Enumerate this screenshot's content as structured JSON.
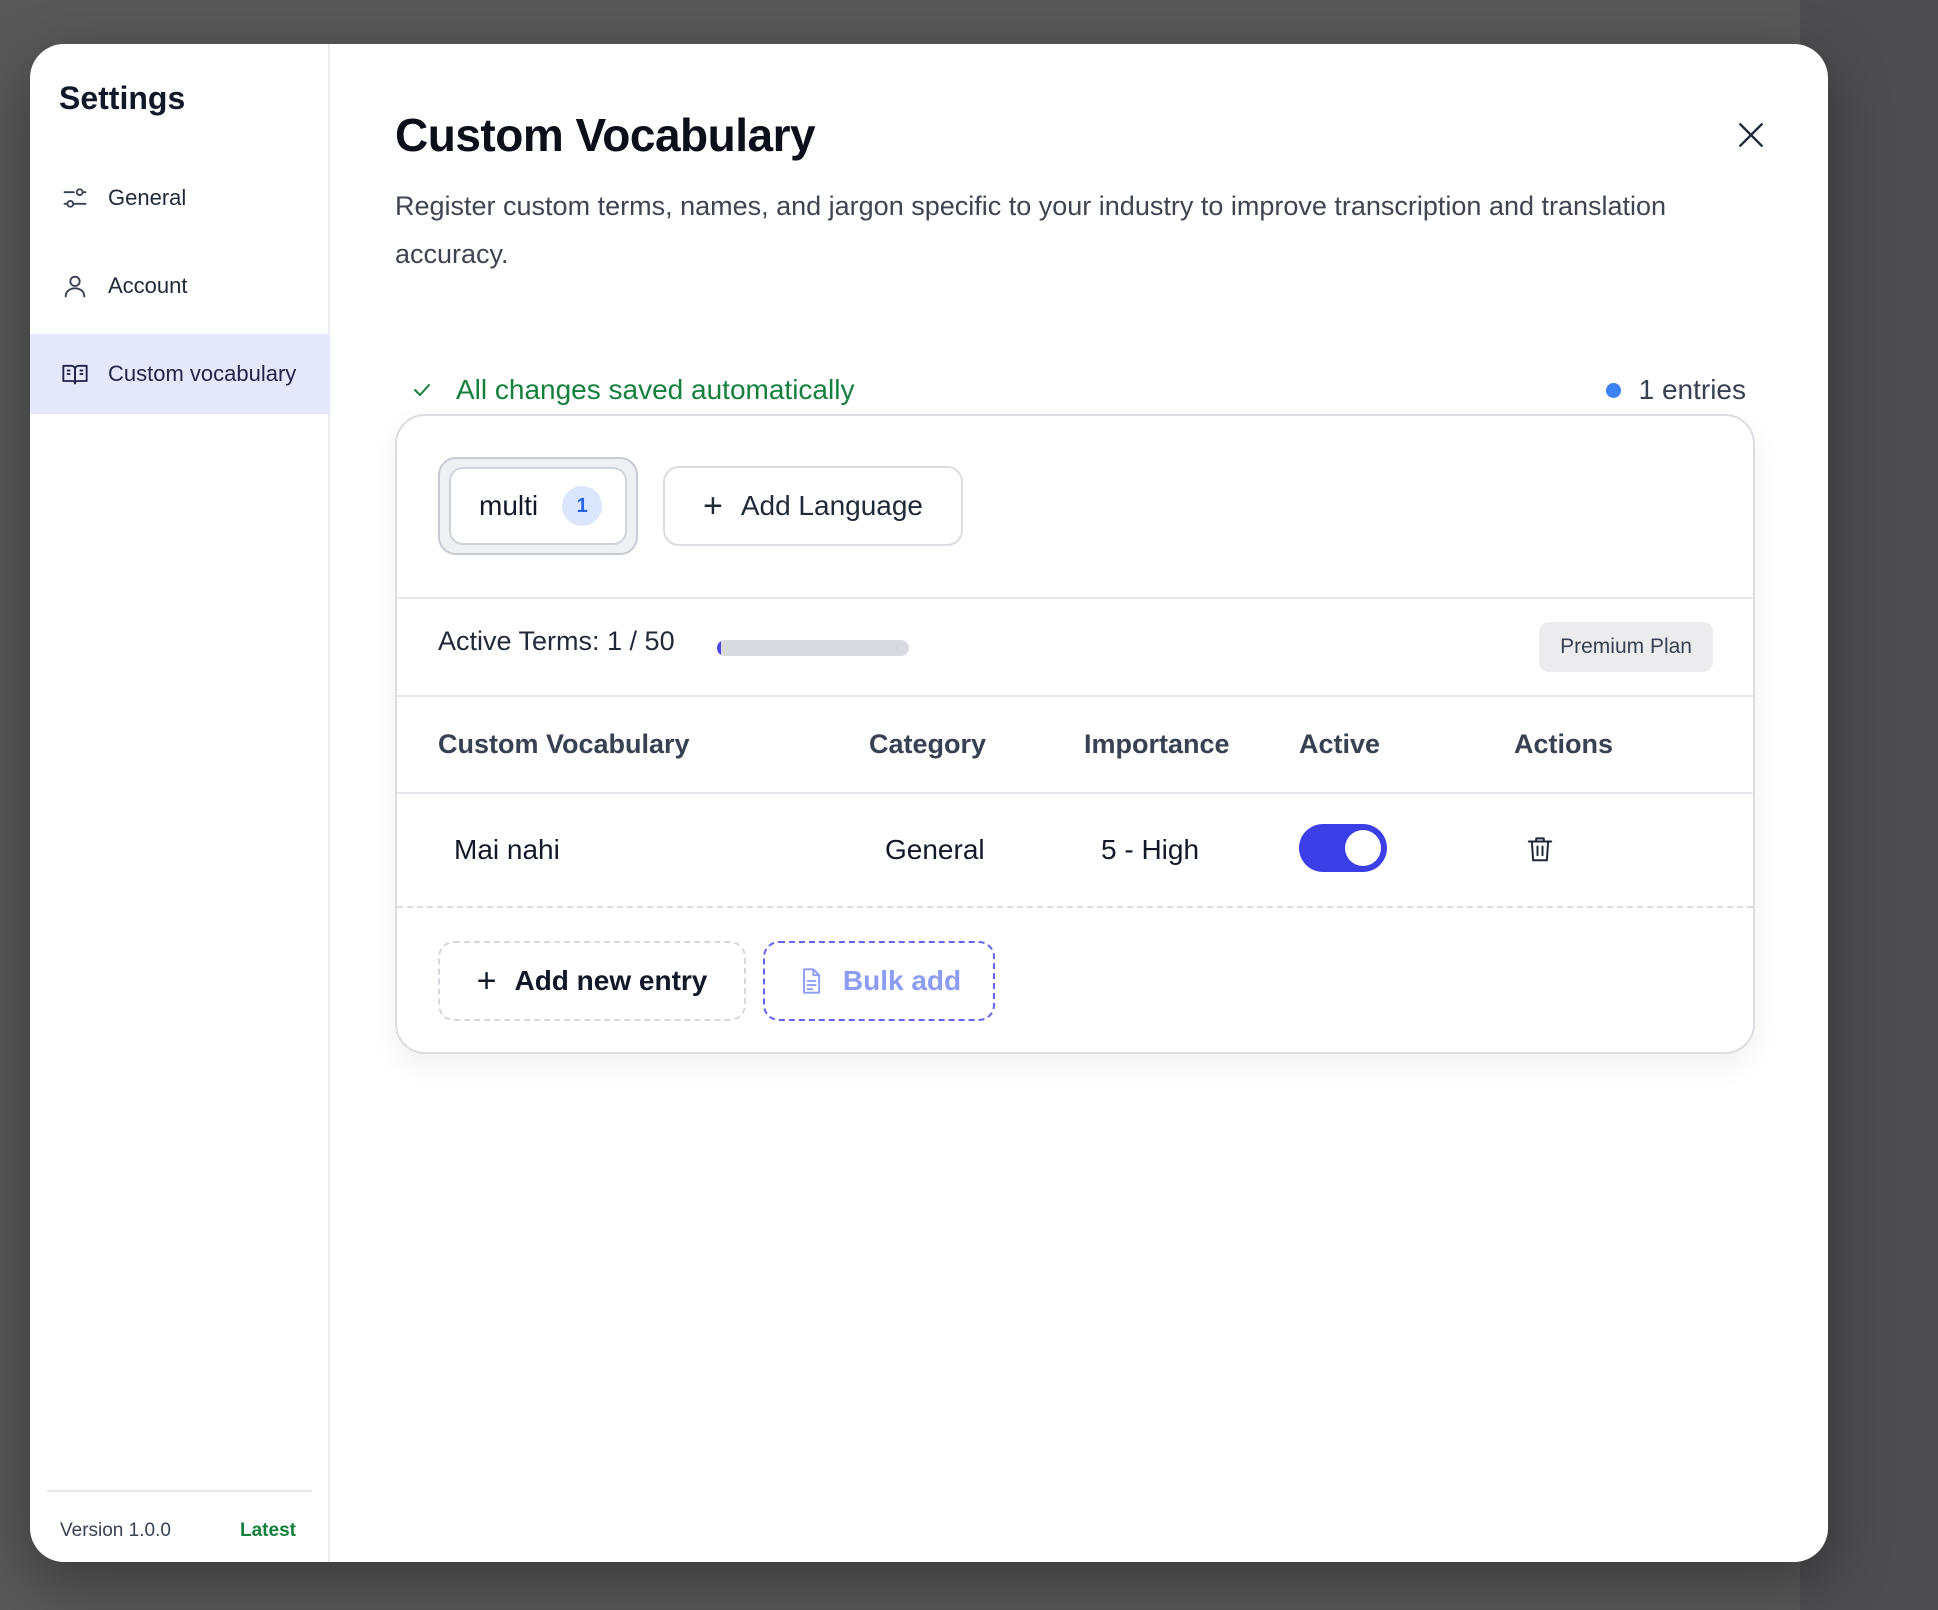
{
  "sidebar": {
    "title": "Settings",
    "items": [
      {
        "label": "General",
        "icon": "sliders-icon",
        "active": false
      },
      {
        "label": "Account",
        "icon": "user-icon",
        "active": false
      },
      {
        "label": "Custom vocabulary",
        "icon": "book-icon",
        "active": true
      }
    ],
    "version": "Version 1.0.0",
    "version_status": "Latest"
  },
  "main": {
    "title": "Custom Vocabulary",
    "description": "Register custom terms, names, and jargon specific to your industry to improve transcription and translation accuracy.",
    "save_status": "All changes saved automatically",
    "entries_count": "1 entries",
    "close_icon": "close-icon"
  },
  "languages": {
    "tabs": [
      {
        "label": "multi",
        "count": "1"
      }
    ],
    "add_label": "Add Language"
  },
  "quota": {
    "label": "Active Terms: 1 / 50",
    "used": 1,
    "limit": 50,
    "plan": "Premium Plan"
  },
  "table": {
    "headers": [
      "Custom Vocabulary",
      "Category",
      "Importance",
      "Active",
      "Actions"
    ],
    "rows": [
      {
        "term": "Mai nahi",
        "category": "General",
        "importance": "5 - High",
        "active": true
      }
    ]
  },
  "actions": {
    "add_entry": "Add new entry",
    "bulk_add": "Bulk add"
  },
  "colors": {
    "accent": "#3c3fe8",
    "success": "#15803d",
    "dot": "#3b82f6"
  }
}
